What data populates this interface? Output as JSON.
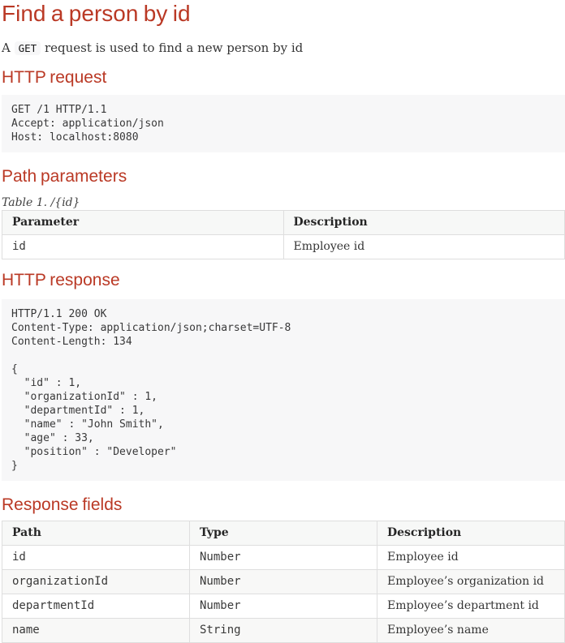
{
  "page": {
    "title": "Find a person by id",
    "intro": {
      "prefix": "A ",
      "code": "GET",
      "suffix": " request is used to find a new person by id"
    }
  },
  "http_request": {
    "heading": "HTTP request",
    "code": "GET /1 HTTP/1.1\nAccept: application/json\nHost: localhost:8080"
  },
  "path_parameters": {
    "heading": "Path parameters",
    "caption": "Table 1. /{id}",
    "headers": [
      "Parameter",
      "Description"
    ],
    "rows": [
      {
        "parameter": "id",
        "description": "Employee id"
      }
    ]
  },
  "http_response": {
    "heading": "HTTP response",
    "code": "HTTP/1.1 200 OK\nContent-Type: application/json;charset=UTF-8\nContent-Length: 134\n\n{\n  \"id\" : 1,\n  \"organizationId\" : 1,\n  \"departmentId\" : 1,\n  \"name\" : \"John Smith\",\n  \"age\" : 33,\n  \"position\" : \"Developer\"\n}"
  },
  "response_fields": {
    "heading": "Response fields",
    "headers": [
      "Path",
      "Type",
      "Description"
    ],
    "rows": [
      {
        "path": "id",
        "type": "Number",
        "description": "Employee id"
      },
      {
        "path": "organizationId",
        "type": "Number",
        "description": "Employee’s organization id"
      },
      {
        "path": "departmentId",
        "type": "Number",
        "description": "Employee’s department id"
      },
      {
        "path": "name",
        "type": "String",
        "description": "Employee’s name"
      }
    ]
  },
  "colors": {
    "heading_accent": "#ba3925",
    "code_background": "#f7f7f8",
    "table_border": "#dedede",
    "table_header_background": "#f7f8f7",
    "table_stripe_background": "#f8f8f7"
  }
}
